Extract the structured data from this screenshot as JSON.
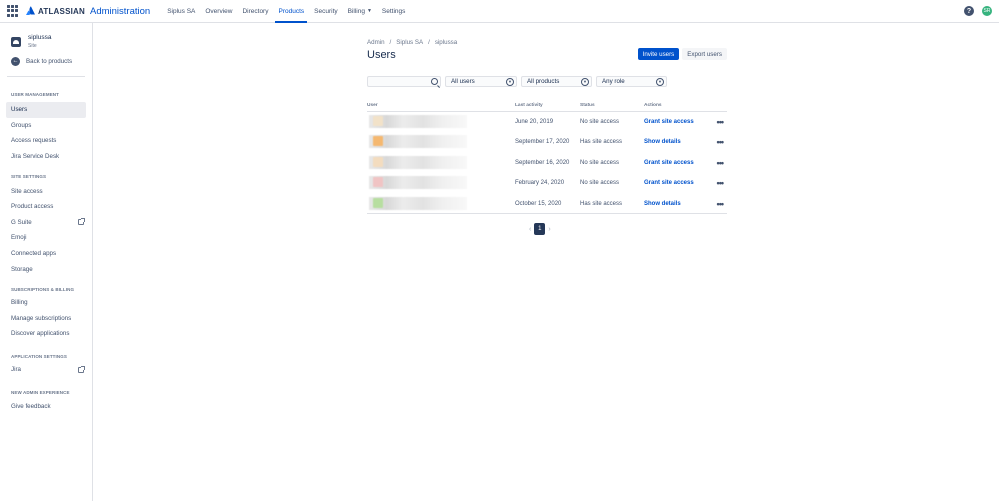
{
  "topbar": {
    "brand": "ATLASSIAN",
    "product": "Administration",
    "nav": [
      {
        "label": "Siplus SA",
        "active": false
      },
      {
        "label": "Overview",
        "active": false
      },
      {
        "label": "Directory",
        "active": false
      },
      {
        "label": "Products",
        "active": true
      },
      {
        "label": "Security",
        "active": false
      },
      {
        "label": "Billing",
        "active": false
      },
      {
        "label": "Settings",
        "active": false
      }
    ],
    "avatar_initials": "SR"
  },
  "sidebar": {
    "site_name": "siplussa",
    "site_type": "Site",
    "back_label": "Back to products",
    "sections": {
      "user_management": "User management",
      "site_settings": "Site settings",
      "subscriptions": "Subscriptions & billing",
      "app_settings": "Application settings",
      "new_admin": "New admin experience"
    },
    "user_items": [
      "Users",
      "Groups",
      "Access requests",
      "Jira Service Desk"
    ],
    "site_items": [
      "Site access",
      "Product access",
      "G Suite",
      "Emoji",
      "Connected apps",
      "Storage"
    ],
    "billing_items": [
      "Billing",
      "Manage subscriptions",
      "Discover applications"
    ],
    "app_items": [
      "Jira"
    ],
    "new_admin_items": [
      "Give feedback"
    ]
  },
  "main": {
    "breadcrumb": [
      "Admin",
      "Siplus SA",
      "siplussa"
    ],
    "title": "Users",
    "invite_label": "Invite users",
    "export_label": "Export users",
    "search_placeholder": "",
    "filter_users": "All users",
    "filter_products": "All products",
    "filter_role": "Any role",
    "headers": {
      "user": "User",
      "last_activity": "Last activity",
      "status": "Status",
      "actions": "Actions"
    },
    "rows": [
      {
        "last_activity": "June 20, 2019",
        "status": "No site access",
        "action": "Grant site access",
        "swatch": "#f2e2c9"
      },
      {
        "last_activity": "September 17, 2020",
        "status": "Has site access",
        "action": "Show details",
        "swatch": "#f5b870"
      },
      {
        "last_activity": "September 16, 2020",
        "status": "No site access",
        "action": "Grant site access",
        "swatch": "#f3dcbf"
      },
      {
        "last_activity": "February 24, 2020",
        "status": "No site access",
        "action": "Grant site access",
        "swatch": "#f0c4c4"
      },
      {
        "last_activity": "October 15, 2020",
        "status": "Has site access",
        "action": "Show details",
        "swatch": "#b7dea0"
      }
    ],
    "page_current": "1"
  }
}
